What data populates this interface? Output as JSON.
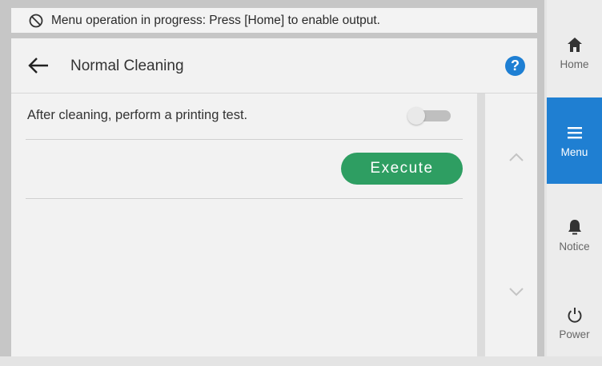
{
  "status_banner": {
    "icon": "prohibited-icon",
    "text": "Menu operation in progress: Press [Home] to enable output."
  },
  "panel": {
    "title": "Normal Cleaning",
    "back_icon": "back-arrow-icon",
    "help_label": "?",
    "option": {
      "label": "After cleaning, perform a printing test.",
      "toggle_on": false
    },
    "execute_label": "Execute"
  },
  "scroll": {
    "up_icon": "chevron-up-icon",
    "down_icon": "chevron-down-icon"
  },
  "nav": {
    "items": [
      {
        "label": "Home",
        "icon": "home-icon",
        "active": false
      },
      {
        "label": "Menu",
        "icon": "menu-icon",
        "active": true
      },
      {
        "label": "Notice",
        "icon": "bell-icon",
        "active": false
      },
      {
        "label": "Power",
        "icon": "power-icon",
        "active": false
      }
    ]
  },
  "colors": {
    "accent_blue": "#1f7fd2",
    "execute_green": "#2e9e62",
    "panel_bg": "#f2f2f2"
  }
}
